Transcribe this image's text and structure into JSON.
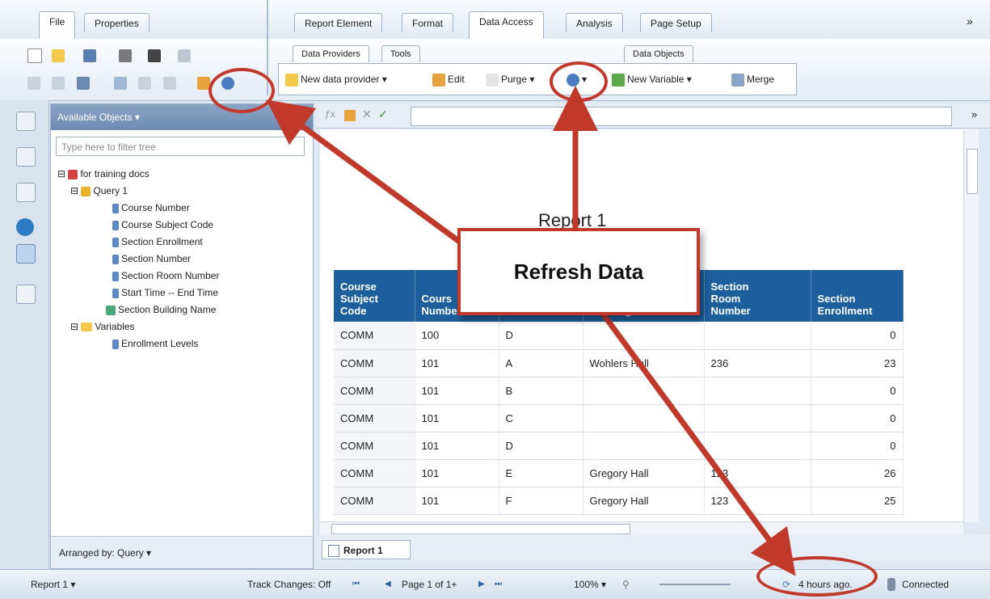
{
  "tabs_left": [
    "File",
    "Properties"
  ],
  "tabs_main": [
    "Report Element",
    "Format",
    "Data Access",
    "Analysis",
    "Page Setup"
  ],
  "overflow_chevron": "»",
  "subtabs": [
    "Data Providers",
    "Tools",
    "Data Objects"
  ],
  "toolbar": {
    "new_data_provider": "New data provider ▾",
    "edit": "Edit",
    "purge": "Purge ▾",
    "new_variable": "New Variable ▾",
    "merge": "Merge"
  },
  "panel": {
    "title": "Available Objects ▾",
    "filter_placeholder": "Type here to filter tree",
    "tree": {
      "root": "for training docs",
      "query": "Query 1",
      "query_items": [
        "Course Number",
        "Course Subject Code",
        "Section Enrollment",
        "Section Number",
        "Section Room Number",
        "Start Time -- End Time",
        "Section Building Name"
      ],
      "variables": "Variables",
      "variable_items": [
        "Enrollment Levels"
      ]
    },
    "footer": "Arranged by: Query ▾"
  },
  "report": {
    "title": "Report 1",
    "columns": [
      "Course Subject Code",
      "Course Number",
      "Section Number",
      "Section Building Name",
      "Section Room Number",
      "Section Enrollment"
    ],
    "header_visible": [
      "Course\nSubject\nCode",
      "Cours\nNumber",
      "Number",
      "Building Name",
      "Section\nRoom\nNumber",
      "Section\nEnrollment"
    ],
    "rows": [
      [
        "COMM",
        "100",
        "D",
        "",
        "",
        "0"
      ],
      [
        "COMM",
        "101",
        "A",
        "Wohlers Hall",
        "236",
        "23"
      ],
      [
        "COMM",
        "101",
        "B",
        "",
        "",
        "0"
      ],
      [
        "COMM",
        "101",
        "C",
        "",
        "",
        "0"
      ],
      [
        "COMM",
        "101",
        "D",
        "",
        "",
        "0"
      ],
      [
        "COMM",
        "101",
        "E",
        "Gregory Hall",
        "123",
        "26"
      ],
      [
        "COMM",
        "101",
        "F",
        "Gregory Hall",
        "123",
        "25"
      ]
    ]
  },
  "report_tab": "Report 1",
  "status": {
    "report_selector": "Report 1 ▾",
    "track_changes": "Track Changes: Off",
    "page": "Page 1 of 1+",
    "zoom": "100% ▾",
    "refresh_time": "4 hours ago.",
    "connection": "Connected"
  },
  "annotation": {
    "callout_text": "Refresh Data"
  },
  "colors": {
    "accent_red": "#c0392b",
    "header_blue": "#1c5f9c"
  }
}
